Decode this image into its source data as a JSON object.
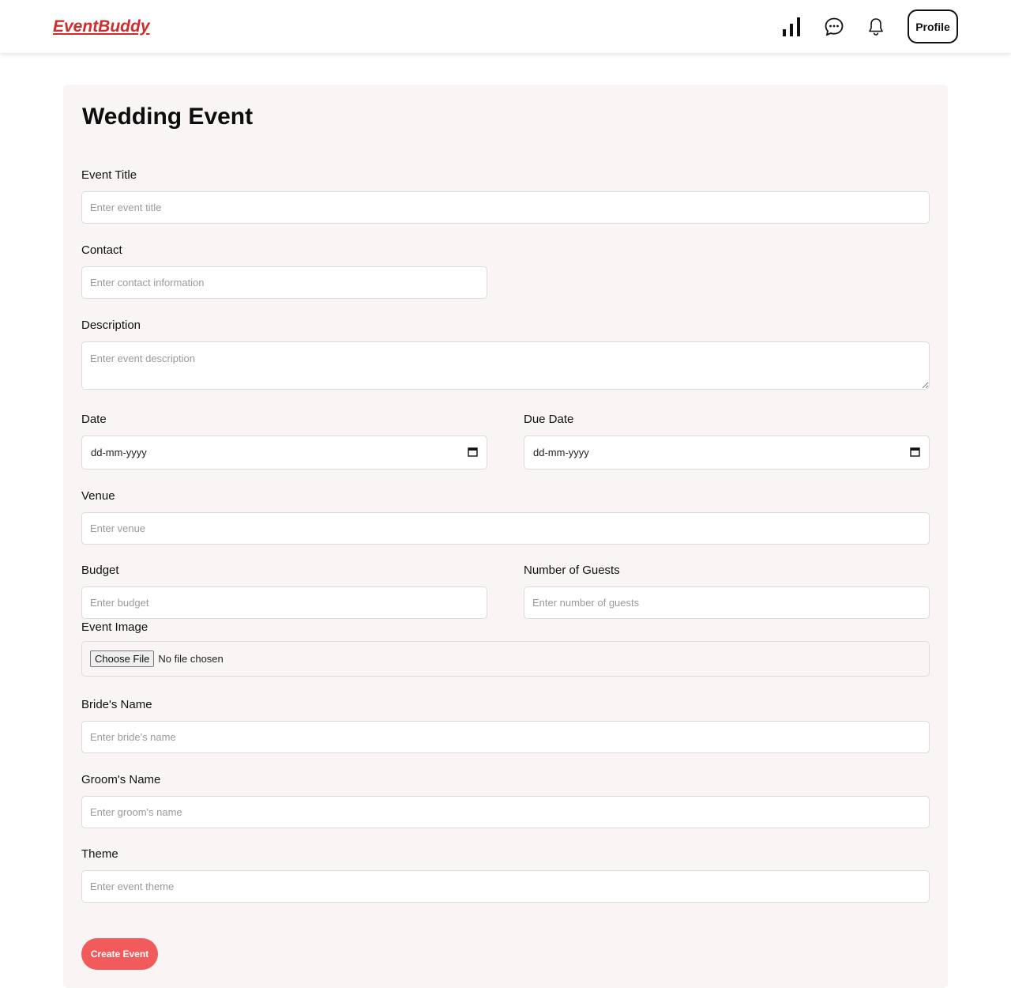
{
  "header": {
    "logo": "EventBuddy",
    "profile_label": "Profile",
    "icons": [
      "bar-chart-icon",
      "chat-icon",
      "bell-icon"
    ]
  },
  "colors": {
    "logo": "#d12b2b",
    "accent": "#f15b5b",
    "card_bg": "#f9f5f4"
  },
  "form": {
    "title": "Wedding Event",
    "event_title": {
      "label": "Event Title",
      "placeholder": "Enter event title"
    },
    "contact": {
      "label": "Contact",
      "placeholder": "Enter contact information"
    },
    "description": {
      "label": "Description",
      "placeholder": "Enter event description"
    },
    "date": {
      "label": "Date",
      "value": "dd-mm-yyyy"
    },
    "due_date": {
      "label": "Due Date",
      "value": "dd-mm-yyyy"
    },
    "venue": {
      "label": "Venue",
      "placeholder": "Enter venue"
    },
    "budget": {
      "label": "Budget",
      "placeholder": "Enter budget"
    },
    "guests": {
      "label": "Number of Guests",
      "placeholder": "Enter number of guests"
    },
    "image": {
      "label": "Event Image",
      "button": "Choose File",
      "status": "No file chosen"
    },
    "bride": {
      "label": "Bride's Name",
      "placeholder": "Enter bride's name"
    },
    "groom": {
      "label": "Groom's Name",
      "placeholder": "Enter groom's name"
    },
    "theme": {
      "label": "Theme",
      "placeholder": "Enter event theme"
    },
    "submit_label": "Create Event"
  }
}
